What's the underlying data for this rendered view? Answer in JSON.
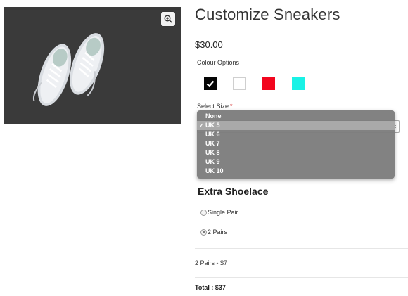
{
  "product": {
    "title": "Customize Sneakers",
    "price": "$30.00",
    "image_alt": "white sneakers on dark background"
  },
  "colour": {
    "label": "Colour Options",
    "swatches": [
      {
        "name": "black",
        "hex": "#050505",
        "selected": true
      },
      {
        "name": "white",
        "hex": "#ffffff",
        "selected": false
      },
      {
        "name": "red",
        "hex": "#f2061e",
        "selected": false
      },
      {
        "name": "cyan",
        "hex": "#19f2e6",
        "selected": false
      }
    ]
  },
  "size": {
    "label": "Select Size",
    "required_mark": "*",
    "selected": "UK 5",
    "options": [
      "None",
      "UK 5",
      "UK 6",
      "UK 7",
      "UK 8",
      "UK 9",
      "UK 10"
    ]
  },
  "shoelace": {
    "title": "Extra Shoelace",
    "options": [
      {
        "label": "Single Pair",
        "checked": false
      },
      {
        "label": "2 Pairs",
        "checked": true
      }
    ]
  },
  "summary": {
    "addon_line": "2 Pairs - $7",
    "total": "Total : $37"
  },
  "icons": {
    "zoom": "zoom-in-icon",
    "check": "checkmark-icon",
    "select_arrow": "chevron-updown-icon"
  }
}
